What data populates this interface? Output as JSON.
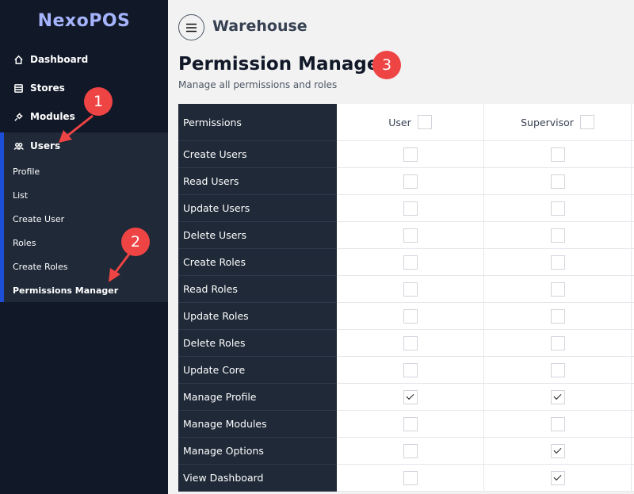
{
  "app": {
    "logo": "NexoPOS",
    "store_name": "Warehouse"
  },
  "sidebar": {
    "items": [
      {
        "label": "Dashboard",
        "icon": "home-icon"
      },
      {
        "label": "Stores",
        "icon": "stores-icon"
      },
      {
        "label": "Modules",
        "icon": "plug-icon"
      },
      {
        "label": "Users",
        "icon": "users-icon"
      }
    ],
    "users_submenu": [
      {
        "label": "Profile"
      },
      {
        "label": "List"
      },
      {
        "label": "Create User"
      },
      {
        "label": "Roles"
      },
      {
        "label": "Create Roles"
      },
      {
        "label": "Permissions Manager",
        "active": true
      }
    ]
  },
  "page": {
    "title": "Permission Manager",
    "subtitle": "Manage all permissions and roles"
  },
  "table": {
    "header": {
      "permissions_label": "Permissions",
      "roles": [
        "User",
        "Supervisor"
      ]
    },
    "rows": [
      {
        "name": "Create Users",
        "user": false,
        "supervisor": false
      },
      {
        "name": "Read Users",
        "user": false,
        "supervisor": false
      },
      {
        "name": "Update Users",
        "user": false,
        "supervisor": false
      },
      {
        "name": "Delete Users",
        "user": false,
        "supervisor": false
      },
      {
        "name": "Create Roles",
        "user": false,
        "supervisor": false
      },
      {
        "name": "Read Roles",
        "user": false,
        "supervisor": false
      },
      {
        "name": "Update Roles",
        "user": false,
        "supervisor": false
      },
      {
        "name": "Delete Roles",
        "user": false,
        "supervisor": false
      },
      {
        "name": "Update Core",
        "user": false,
        "supervisor": false
      },
      {
        "name": "Manage Profile",
        "user": true,
        "supervisor": true
      },
      {
        "name": "Manage Modules",
        "user": false,
        "supervisor": false
      },
      {
        "name": "Manage Options",
        "user": false,
        "supervisor": true
      },
      {
        "name": "View Dashboard",
        "user": false,
        "supervisor": true
      }
    ]
  },
  "annotations": {
    "markers": [
      "1",
      "2",
      "3"
    ],
    "color": "#ef4444"
  }
}
